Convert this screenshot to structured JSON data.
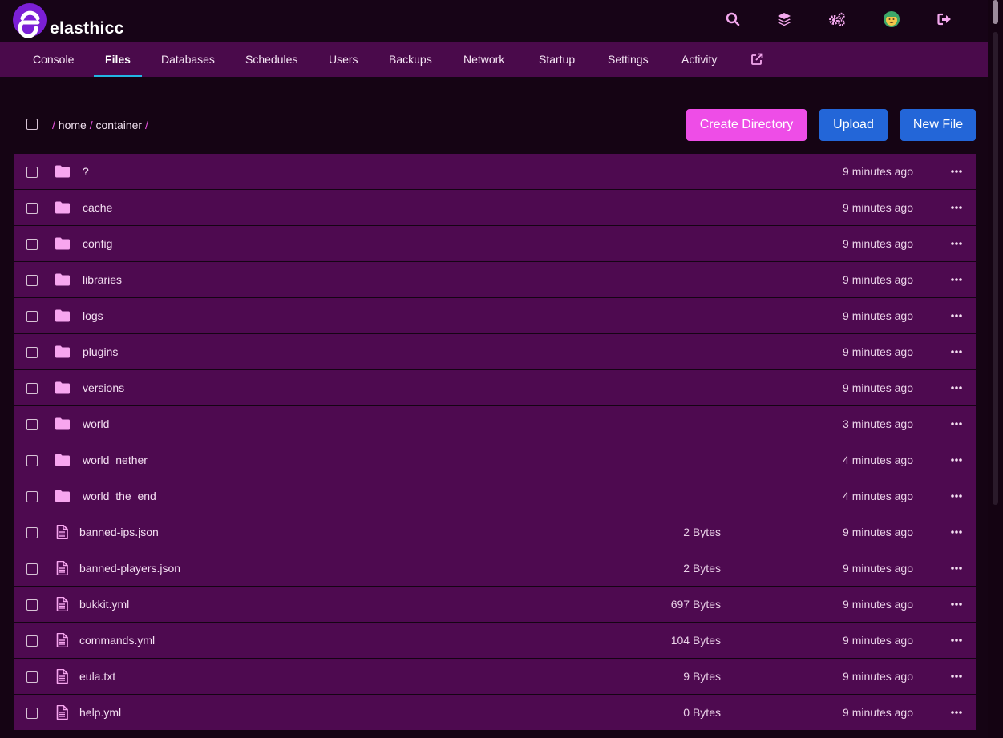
{
  "app": {
    "name": "elasthicc"
  },
  "nav": {
    "items": [
      {
        "label": "Console",
        "active": false
      },
      {
        "label": "Files",
        "active": true
      },
      {
        "label": "Databases",
        "active": false
      },
      {
        "label": "Schedules",
        "active": false
      },
      {
        "label": "Users",
        "active": false
      },
      {
        "label": "Backups",
        "active": false
      },
      {
        "label": "Network",
        "active": false
      },
      {
        "label": "Startup",
        "active": false
      },
      {
        "label": "Settings",
        "active": false
      },
      {
        "label": "Activity",
        "active": false
      }
    ],
    "external_icon": "external-link-icon"
  },
  "top_icons": [
    "search-icon",
    "layers-icon",
    "cogs-icon",
    "avatar",
    "sign-out-icon"
  ],
  "breadcrumb": {
    "sep": "/",
    "parts": [
      "home",
      "container"
    ]
  },
  "buttons": {
    "create_directory": "Create Directory",
    "upload": "Upload",
    "new_file": "New File"
  },
  "files": [
    {
      "name": "?",
      "type": "folder",
      "size": "",
      "modified": "9 minutes ago"
    },
    {
      "name": "cache",
      "type": "folder",
      "size": "",
      "modified": "9 minutes ago"
    },
    {
      "name": "config",
      "type": "folder",
      "size": "",
      "modified": "9 minutes ago"
    },
    {
      "name": "libraries",
      "type": "folder",
      "size": "",
      "modified": "9 minutes ago"
    },
    {
      "name": "logs",
      "type": "folder",
      "size": "",
      "modified": "9 minutes ago"
    },
    {
      "name": "plugins",
      "type": "folder",
      "size": "",
      "modified": "9 minutes ago"
    },
    {
      "name": "versions",
      "type": "folder",
      "size": "",
      "modified": "9 minutes ago"
    },
    {
      "name": "world",
      "type": "folder",
      "size": "",
      "modified": "3 minutes ago"
    },
    {
      "name": "world_nether",
      "type": "folder",
      "size": "",
      "modified": "4 minutes ago"
    },
    {
      "name": "world_the_end",
      "type": "folder",
      "size": "",
      "modified": "4 minutes ago"
    },
    {
      "name": "banned-ips.json",
      "type": "file",
      "size": "2 Bytes",
      "modified": "9 minutes ago"
    },
    {
      "name": "banned-players.json",
      "type": "file",
      "size": "2 Bytes",
      "modified": "9 minutes ago"
    },
    {
      "name": "bukkit.yml",
      "type": "file",
      "size": "697 Bytes",
      "modified": "9 minutes ago"
    },
    {
      "name": "commands.yml",
      "type": "file",
      "size": "104 Bytes",
      "modified": "9 minutes ago"
    },
    {
      "name": "eula.txt",
      "type": "file",
      "size": "9 Bytes",
      "modified": "9 minutes ago"
    },
    {
      "name": "help.yml",
      "type": "file",
      "size": "0 Bytes",
      "modified": "9 minutes ago"
    }
  ],
  "colors": {
    "accent": "#ee4de7",
    "primary_button": "#2366d8",
    "nav_bg": "#4a0a4b",
    "row_bg": "#4e0a50",
    "icon_pink": "#f7a6ef",
    "active_underline": "#22b8e3"
  }
}
